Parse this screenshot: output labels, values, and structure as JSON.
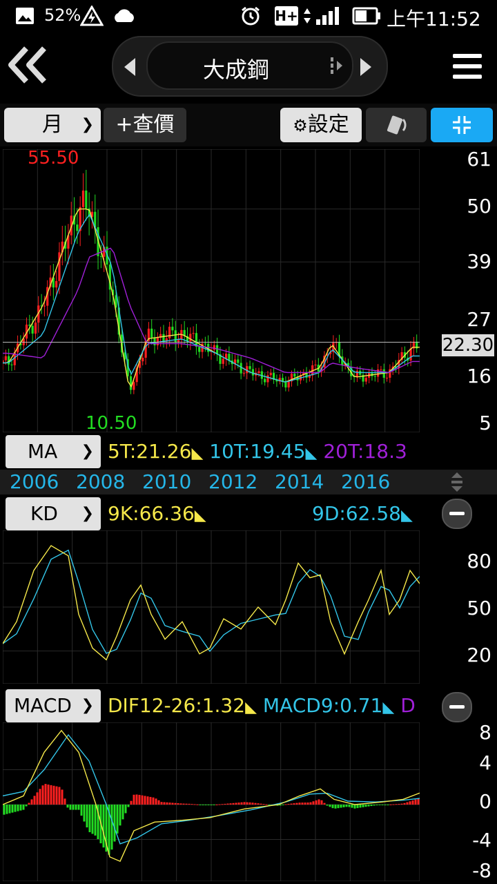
{
  "status": {
    "battery_pct": "52%",
    "network": "H+",
    "time": "上午11:52"
  },
  "nav": {
    "title": "大成鋼"
  },
  "toolbar": {
    "period_label": "月",
    "price_label": "+查價",
    "settings_label": "設定"
  },
  "main_chart": {
    "high_label": "55.50",
    "low_label": "10.50",
    "current_price": "22.30",
    "y_ticks": [
      "61",
      "50",
      "39",
      "27",
      "16",
      "5"
    ]
  },
  "ma": {
    "label": "MA",
    "ma5": "5T:21.26",
    "ma10": "10T:19.45",
    "ma20": "20T:18.3"
  },
  "years": [
    "2006",
    "2008",
    "2010",
    "2012",
    "2014",
    "2016"
  ],
  "kd": {
    "label": "KD",
    "k": "9K:66.36",
    "d": "9D:62.58",
    "y_ticks": [
      "80",
      "50",
      "20"
    ]
  },
  "macd": {
    "label": "MACD",
    "dif": "DIF12-26:1.32",
    "macd9": "MACD9:0.71",
    "d": "D",
    "y_ticks": [
      "8",
      "4",
      "0",
      "-4",
      "-8"
    ]
  },
  "colors": {
    "up": "#ff2020",
    "down": "#22dd22",
    "ma5": "#f5e84a",
    "ma10": "#33c5e8",
    "ma20": "#a020d8",
    "accent": "#1aa9f4"
  },
  "chart_data": {
    "type": "line",
    "title": "大成鋼",
    "x_range": [
      "2005",
      "2017"
    ],
    "ylim": [
      5,
      61
    ],
    "series": [
      {
        "name": "5T",
        "x": [
          "2005-06",
          "2006-06",
          "2007-06",
          "2007-10",
          "2008-06",
          "2008-12",
          "2009-06",
          "2010-06",
          "2011-06",
          "2012-06",
          "2013-06",
          "2014-06",
          "2014-10",
          "2015-06",
          "2016-06",
          "2017-02"
        ],
        "values": [
          18,
          30,
          50,
          50,
          33,
          12,
          23,
          24,
          20,
          16,
          14,
          17,
          22,
          15,
          16,
          21.26
        ]
      },
      {
        "name": "10T",
        "x": [
          "2005-06",
          "2006-06",
          "2007-06",
          "2007-10",
          "2008-06",
          "2008-12",
          "2009-06",
          "2010-06",
          "2011-06",
          "2012-06",
          "2013-06",
          "2014-06",
          "2014-10",
          "2015-06",
          "2016-06",
          "2017-02"
        ],
        "values": [
          18,
          24,
          45,
          49,
          38,
          15,
          22,
          23,
          20,
          16,
          14,
          16,
          21,
          16,
          16,
          19.45
        ]
      },
      {
        "name": "20T",
        "x": [
          "2005-06",
          "2006-06",
          "2007-06",
          "2007-10",
          "2008-06",
          "2008-12",
          "2009-06",
          "2010-06",
          "2011-06",
          "2012-06",
          "2013-06",
          "2014-06",
          "2014-10",
          "2015-06",
          "2016-06",
          "2017-02"
        ],
        "values": [
          20,
          19,
          33,
          40,
          42,
          30,
          22,
          22,
          21,
          19,
          16,
          16,
          18,
          17,
          16,
          18.3
        ]
      }
    ]
  }
}
